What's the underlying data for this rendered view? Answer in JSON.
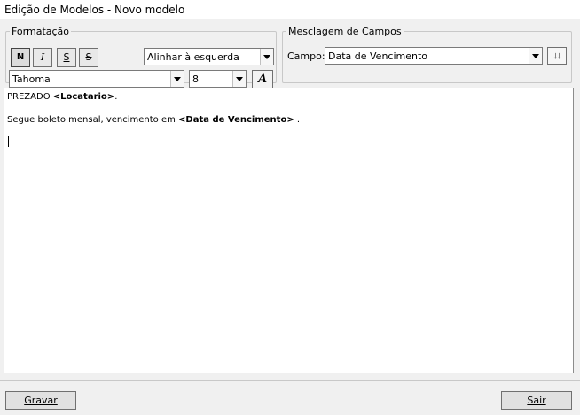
{
  "window": {
    "title": "Edição de Modelos - Novo modelo"
  },
  "formatacao": {
    "legend": "Formatação",
    "bold_label": "N",
    "italic_label": "I",
    "underline_label": "S",
    "strike_label": "S",
    "alignment": "Alinhar à esquerda",
    "font": "Tahoma",
    "size": "8",
    "color_label": "A"
  },
  "mesclagem": {
    "legend": "Mesclagem de Campos",
    "campo_label": "Campo:",
    "campo_value": "Data de Vencimento",
    "insert_label": "↓↓"
  },
  "editor": {
    "line1_prefix": "PREZADO ",
    "line1_field": "<Locatario>",
    "line1_suffix": ".",
    "line2_prefix": "Segue boleto mensal, vencimento em ",
    "line2_field": "<Data de Vencimento>",
    "line2_suffix": " ."
  },
  "footer": {
    "gravar_label": "Gravar",
    "sair_label": "Sair"
  }
}
